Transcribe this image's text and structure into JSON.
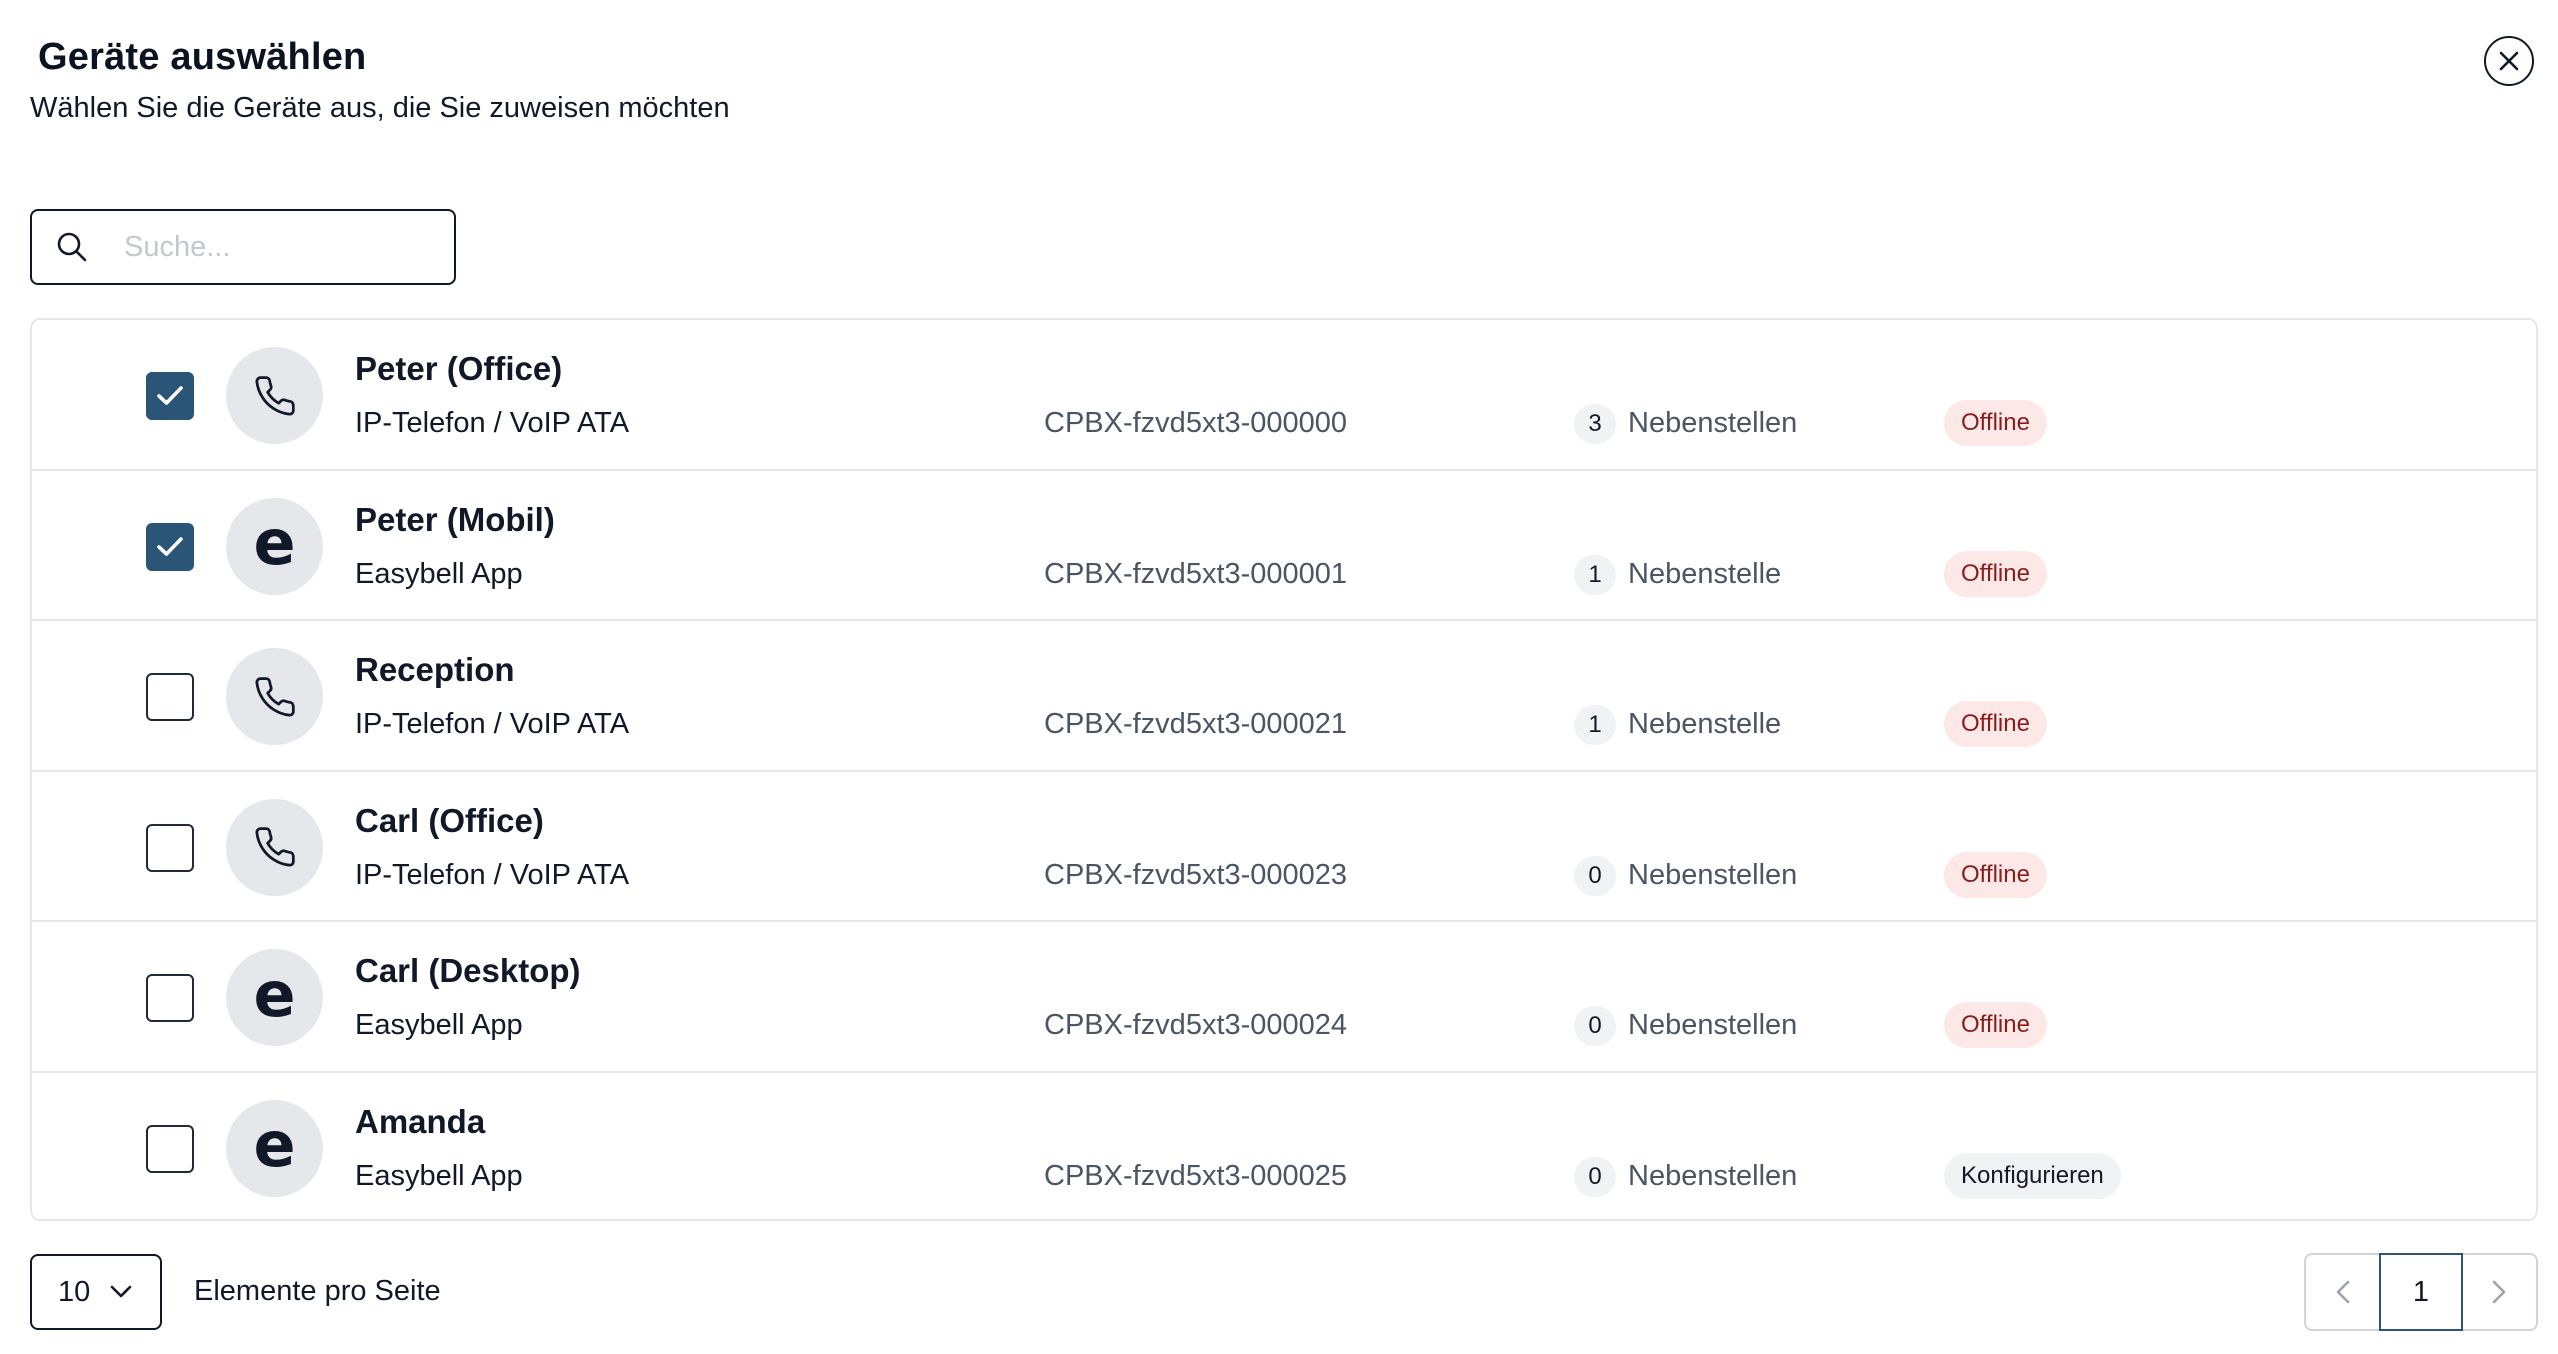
{
  "dialog": {
    "title": "Geräte auswählen",
    "subtitle": "Wählen Sie die Geräte aus, die Sie zuweisen möchten"
  },
  "search": {
    "placeholder": "Suche...",
    "value": ""
  },
  "devices": [
    {
      "checked": true,
      "icon": "phone-icon",
      "name": "Peter (Office)",
      "type": "IP-Telefon / VoIP ATA",
      "id": "CPBX-fzvd5xt3-000000",
      "ext_count": "3",
      "ext_label": "Nebenstellen",
      "status": "Offline",
      "status_kind": "offline"
    },
    {
      "checked": true,
      "icon": "easybell-e-icon",
      "name": "Peter (Mobil)",
      "type": "Easybell App",
      "id": "CPBX-fzvd5xt3-000001",
      "ext_count": "1",
      "ext_label": "Nebenstelle",
      "status": "Offline",
      "status_kind": "offline"
    },
    {
      "checked": false,
      "icon": "phone-icon",
      "name": "Reception",
      "type": "IP-Telefon / VoIP ATA",
      "id": "CPBX-fzvd5xt3-000021",
      "ext_count": "1",
      "ext_label": "Nebenstelle",
      "status": "Offline",
      "status_kind": "offline"
    },
    {
      "checked": false,
      "icon": "phone-icon",
      "name": "Carl (Office)",
      "type": "IP-Telefon / VoIP ATA",
      "id": "CPBX-fzvd5xt3-000023",
      "ext_count": "0",
      "ext_label": "Nebenstellen",
      "status": "Offline",
      "status_kind": "offline"
    },
    {
      "checked": false,
      "icon": "easybell-e-icon",
      "name": "Carl (Desktop)",
      "type": "Easybell App",
      "id": "CPBX-fzvd5xt3-000024",
      "ext_count": "0",
      "ext_label": "Nebenstellen",
      "status": "Offline",
      "status_kind": "offline"
    },
    {
      "checked": false,
      "icon": "easybell-e-icon",
      "name": "Amanda",
      "type": "Easybell App",
      "id": "CPBX-fzvd5xt3-000025",
      "ext_count": "0",
      "ext_label": "Nebenstellen",
      "status": "Konfigurieren",
      "status_kind": "configure"
    }
  ],
  "easybell_glyph": "e",
  "footer": {
    "per_page_value": "10",
    "per_page_label": "Elemente pro Seite",
    "current_page": "1"
  },
  "colors": {
    "checkbox_checked": "#2a5577",
    "offline_bg": "#fde8e8",
    "offline_text": "#8b1c1c",
    "divider": "#e5e7eb"
  }
}
